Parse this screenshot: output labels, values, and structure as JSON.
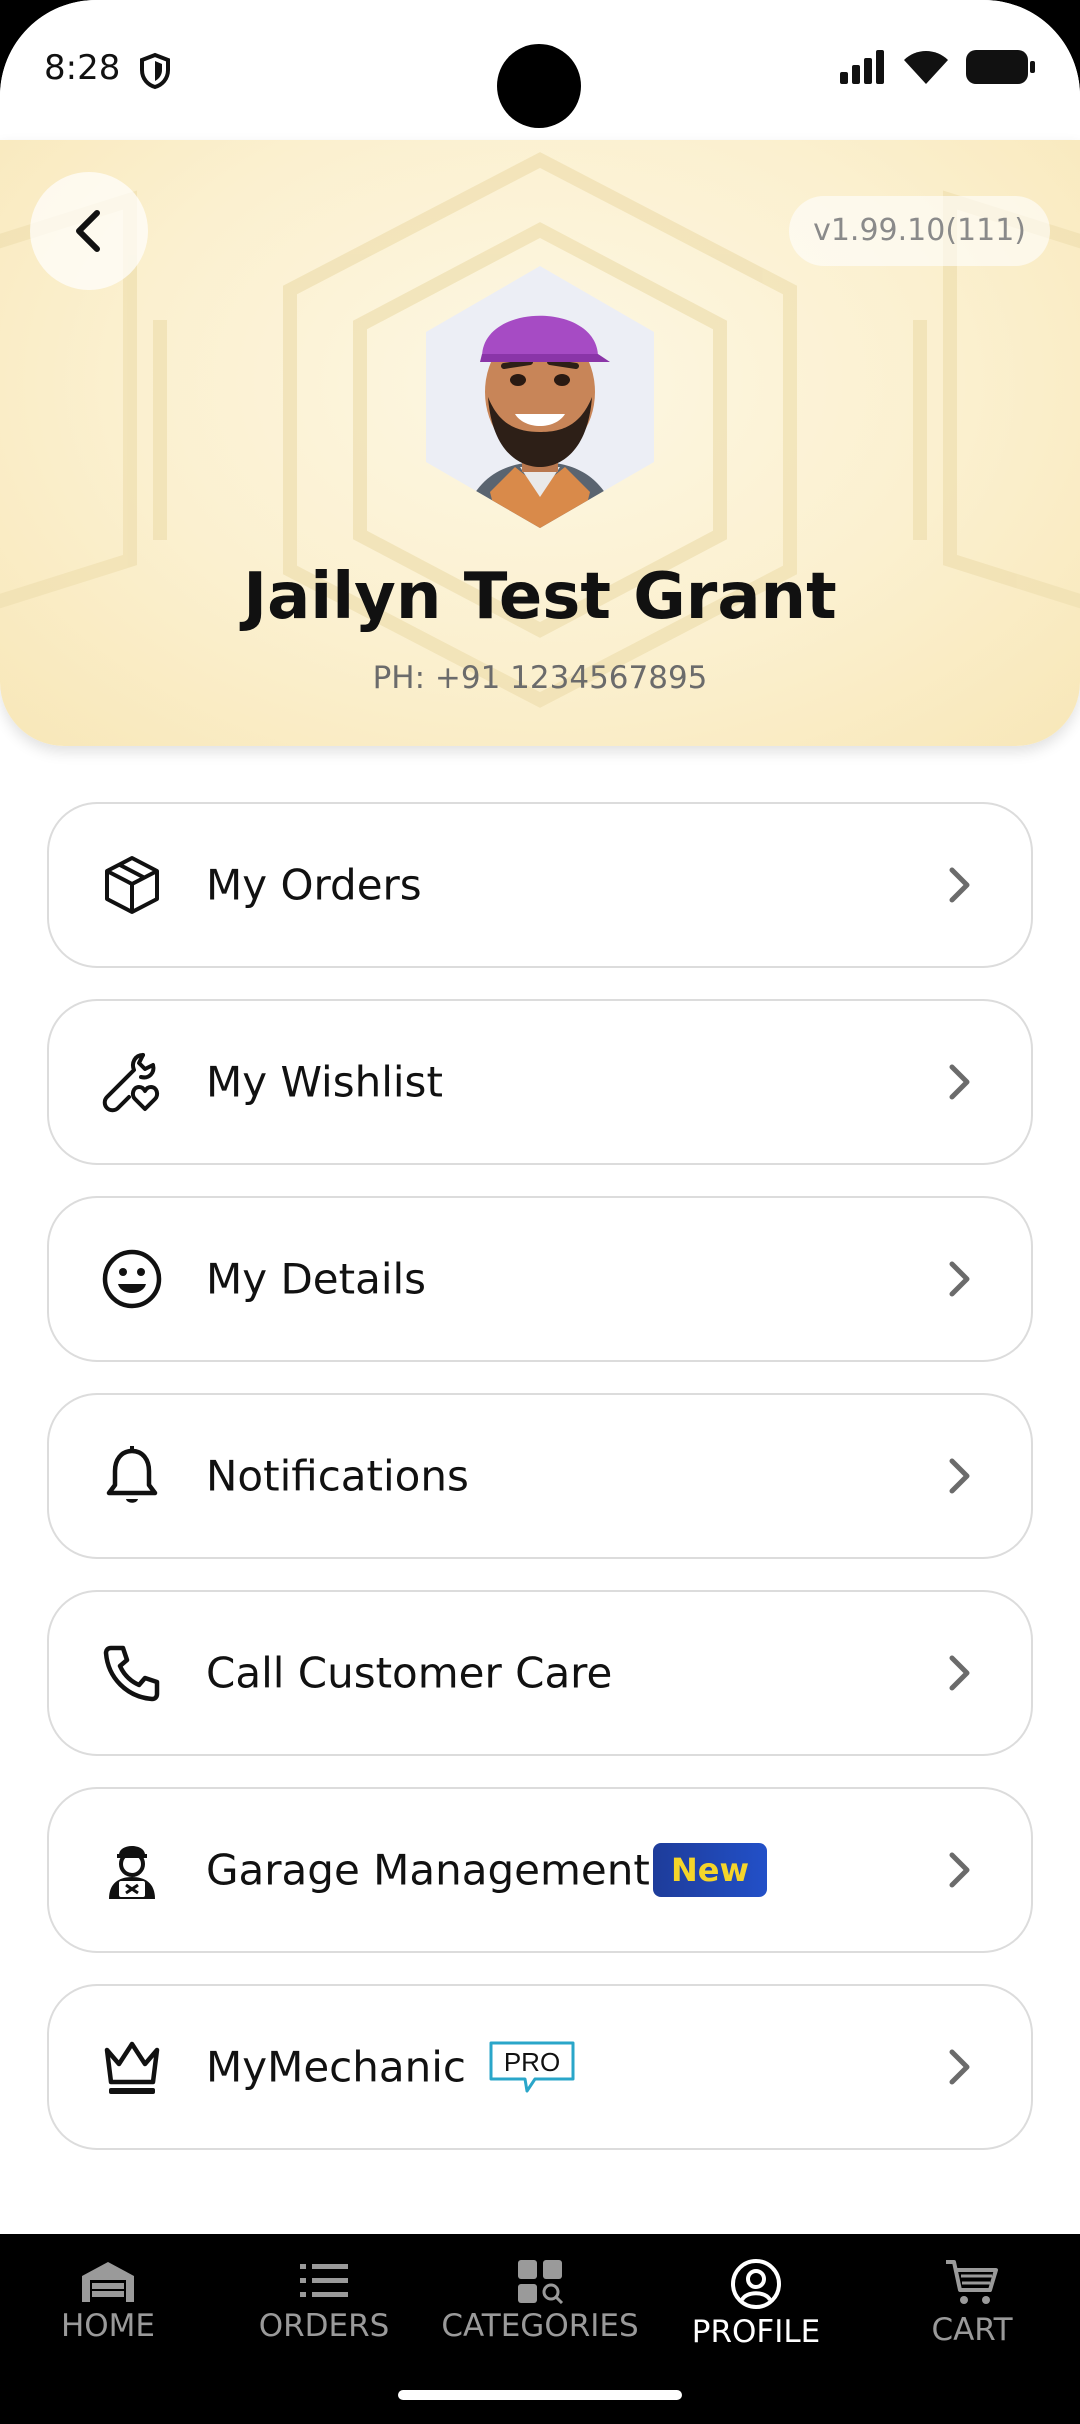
{
  "status_bar": {
    "time": "8:28"
  },
  "header": {
    "version": "v1.99.10(111)",
    "user_name": "Jailyn Test Grant",
    "phone": "PH: +91 1234567895"
  },
  "menu": {
    "items": [
      {
        "label": "My Orders",
        "icon": "box-icon"
      },
      {
        "label": "My Wishlist",
        "icon": "wrench-heart-icon"
      },
      {
        "label": "My Details",
        "icon": "smiley-icon"
      },
      {
        "label": "Notifications",
        "icon": "bell-icon"
      },
      {
        "label": "Call Customer Care",
        "icon": "phone-icon"
      },
      {
        "label": "Garage Management",
        "icon": "mechanic-icon",
        "badge": "New"
      },
      {
        "label": "MyMechanic",
        "icon": "crown-icon",
        "badge": "PRO"
      }
    ]
  },
  "nav": {
    "items": [
      {
        "label": "HOME",
        "icon": "garage-icon"
      },
      {
        "label": "ORDERS",
        "icon": "list-icon"
      },
      {
        "label": "CATEGORIES",
        "icon": "grid-icon"
      },
      {
        "label": "PROFILE",
        "icon": "profile-icon",
        "active": true
      },
      {
        "label": "CART",
        "icon": "cart-icon"
      }
    ]
  },
  "colors": {
    "header_bg": "#fbf0cf",
    "badge_new_bg": "#1e3c9a",
    "badge_new_text": "#f5d52a",
    "badge_pro": "#2aa6c9",
    "nav_bg": "#000000",
    "nav_inactive": "#9a9a9a",
    "nav_active": "#ffffff"
  }
}
